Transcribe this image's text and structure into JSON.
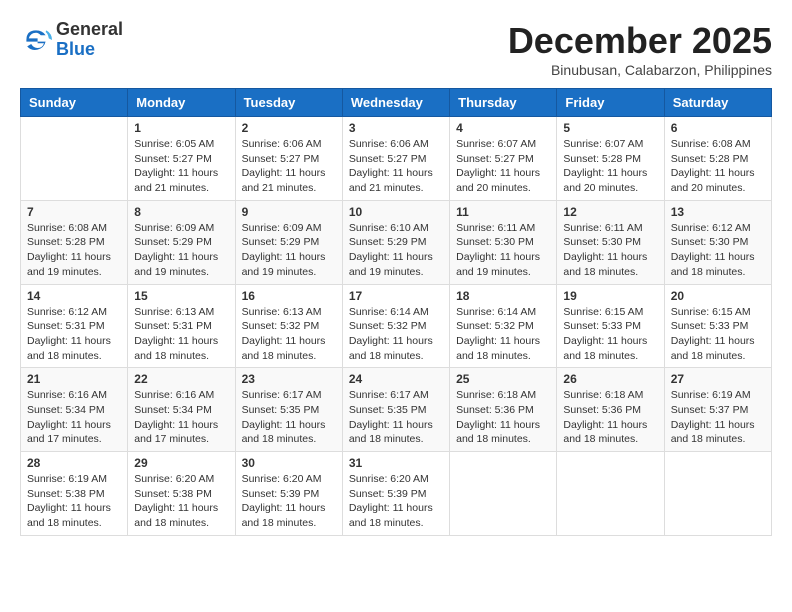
{
  "header": {
    "logo_line1": "General",
    "logo_line2": "Blue",
    "month_year": "December 2025",
    "location": "Binubusan, Calabarzon, Philippines"
  },
  "days_of_week": [
    "Sunday",
    "Monday",
    "Tuesday",
    "Wednesday",
    "Thursday",
    "Friday",
    "Saturday"
  ],
  "weeks": [
    [
      {
        "day": "",
        "sunrise": "",
        "sunset": "",
        "daylight": ""
      },
      {
        "day": "1",
        "sunrise": "Sunrise: 6:05 AM",
        "sunset": "Sunset: 5:27 PM",
        "daylight": "Daylight: 11 hours and 21 minutes."
      },
      {
        "day": "2",
        "sunrise": "Sunrise: 6:06 AM",
        "sunset": "Sunset: 5:27 PM",
        "daylight": "Daylight: 11 hours and 21 minutes."
      },
      {
        "day": "3",
        "sunrise": "Sunrise: 6:06 AM",
        "sunset": "Sunset: 5:27 PM",
        "daylight": "Daylight: 11 hours and 21 minutes."
      },
      {
        "day": "4",
        "sunrise": "Sunrise: 6:07 AM",
        "sunset": "Sunset: 5:27 PM",
        "daylight": "Daylight: 11 hours and 20 minutes."
      },
      {
        "day": "5",
        "sunrise": "Sunrise: 6:07 AM",
        "sunset": "Sunset: 5:28 PM",
        "daylight": "Daylight: 11 hours and 20 minutes."
      },
      {
        "day": "6",
        "sunrise": "Sunrise: 6:08 AM",
        "sunset": "Sunset: 5:28 PM",
        "daylight": "Daylight: 11 hours and 20 minutes."
      }
    ],
    [
      {
        "day": "7",
        "sunrise": "Sunrise: 6:08 AM",
        "sunset": "Sunset: 5:28 PM",
        "daylight": "Daylight: 11 hours and 19 minutes."
      },
      {
        "day": "8",
        "sunrise": "Sunrise: 6:09 AM",
        "sunset": "Sunset: 5:29 PM",
        "daylight": "Daylight: 11 hours and 19 minutes."
      },
      {
        "day": "9",
        "sunrise": "Sunrise: 6:09 AM",
        "sunset": "Sunset: 5:29 PM",
        "daylight": "Daylight: 11 hours and 19 minutes."
      },
      {
        "day": "10",
        "sunrise": "Sunrise: 6:10 AM",
        "sunset": "Sunset: 5:29 PM",
        "daylight": "Daylight: 11 hours and 19 minutes."
      },
      {
        "day": "11",
        "sunrise": "Sunrise: 6:11 AM",
        "sunset": "Sunset: 5:30 PM",
        "daylight": "Daylight: 11 hours and 19 minutes."
      },
      {
        "day": "12",
        "sunrise": "Sunrise: 6:11 AM",
        "sunset": "Sunset: 5:30 PM",
        "daylight": "Daylight: 11 hours and 18 minutes."
      },
      {
        "day": "13",
        "sunrise": "Sunrise: 6:12 AM",
        "sunset": "Sunset: 5:30 PM",
        "daylight": "Daylight: 11 hours and 18 minutes."
      }
    ],
    [
      {
        "day": "14",
        "sunrise": "Sunrise: 6:12 AM",
        "sunset": "Sunset: 5:31 PM",
        "daylight": "Daylight: 11 hours and 18 minutes."
      },
      {
        "day": "15",
        "sunrise": "Sunrise: 6:13 AM",
        "sunset": "Sunset: 5:31 PM",
        "daylight": "Daylight: 11 hours and 18 minutes."
      },
      {
        "day": "16",
        "sunrise": "Sunrise: 6:13 AM",
        "sunset": "Sunset: 5:32 PM",
        "daylight": "Daylight: 11 hours and 18 minutes."
      },
      {
        "day": "17",
        "sunrise": "Sunrise: 6:14 AM",
        "sunset": "Sunset: 5:32 PM",
        "daylight": "Daylight: 11 hours and 18 minutes."
      },
      {
        "day": "18",
        "sunrise": "Sunrise: 6:14 AM",
        "sunset": "Sunset: 5:32 PM",
        "daylight": "Daylight: 11 hours and 18 minutes."
      },
      {
        "day": "19",
        "sunrise": "Sunrise: 6:15 AM",
        "sunset": "Sunset: 5:33 PM",
        "daylight": "Daylight: 11 hours and 18 minutes."
      },
      {
        "day": "20",
        "sunrise": "Sunrise: 6:15 AM",
        "sunset": "Sunset: 5:33 PM",
        "daylight": "Daylight: 11 hours and 18 minutes."
      }
    ],
    [
      {
        "day": "21",
        "sunrise": "Sunrise: 6:16 AM",
        "sunset": "Sunset: 5:34 PM",
        "daylight": "Daylight: 11 hours and 17 minutes."
      },
      {
        "day": "22",
        "sunrise": "Sunrise: 6:16 AM",
        "sunset": "Sunset: 5:34 PM",
        "daylight": "Daylight: 11 hours and 17 minutes."
      },
      {
        "day": "23",
        "sunrise": "Sunrise: 6:17 AM",
        "sunset": "Sunset: 5:35 PM",
        "daylight": "Daylight: 11 hours and 18 minutes."
      },
      {
        "day": "24",
        "sunrise": "Sunrise: 6:17 AM",
        "sunset": "Sunset: 5:35 PM",
        "daylight": "Daylight: 11 hours and 18 minutes."
      },
      {
        "day": "25",
        "sunrise": "Sunrise: 6:18 AM",
        "sunset": "Sunset: 5:36 PM",
        "daylight": "Daylight: 11 hours and 18 minutes."
      },
      {
        "day": "26",
        "sunrise": "Sunrise: 6:18 AM",
        "sunset": "Sunset: 5:36 PM",
        "daylight": "Daylight: 11 hours and 18 minutes."
      },
      {
        "day": "27",
        "sunrise": "Sunrise: 6:19 AM",
        "sunset": "Sunset: 5:37 PM",
        "daylight": "Daylight: 11 hours and 18 minutes."
      }
    ],
    [
      {
        "day": "28",
        "sunrise": "Sunrise: 6:19 AM",
        "sunset": "Sunset: 5:38 PM",
        "daylight": "Daylight: 11 hours and 18 minutes."
      },
      {
        "day": "29",
        "sunrise": "Sunrise: 6:20 AM",
        "sunset": "Sunset: 5:38 PM",
        "daylight": "Daylight: 11 hours and 18 minutes."
      },
      {
        "day": "30",
        "sunrise": "Sunrise: 6:20 AM",
        "sunset": "Sunset: 5:39 PM",
        "daylight": "Daylight: 11 hours and 18 minutes."
      },
      {
        "day": "31",
        "sunrise": "Sunrise: 6:20 AM",
        "sunset": "Sunset: 5:39 PM",
        "daylight": "Daylight: 11 hours and 18 minutes."
      },
      {
        "day": "",
        "sunrise": "",
        "sunset": "",
        "daylight": ""
      },
      {
        "day": "",
        "sunrise": "",
        "sunset": "",
        "daylight": ""
      },
      {
        "day": "",
        "sunrise": "",
        "sunset": "",
        "daylight": ""
      }
    ]
  ]
}
